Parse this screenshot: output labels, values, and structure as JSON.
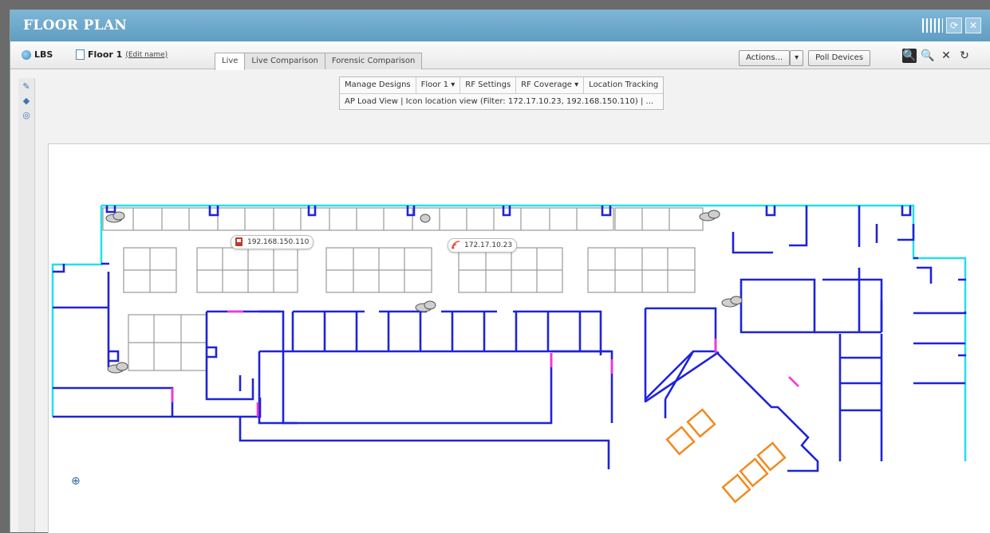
{
  "window": {
    "title": "FLOOR PLAN",
    "refresh_icon": "refresh-icon",
    "close_icon": "close-icon"
  },
  "toolbar": {
    "lbs_label": "LBS",
    "floor_label": "Floor 1",
    "edit_name_link": "(Edit name)",
    "tabs": [
      {
        "label": "Live",
        "active": true
      },
      {
        "label": "Live Comparison",
        "active": false
      },
      {
        "label": "Forensic Comparison",
        "active": false
      }
    ],
    "actions_label": "Actions...",
    "actions_caret": "▾",
    "poll_devices_label": "Poll Devices",
    "zoom_tools": [
      "zoom-select-icon",
      "zoom-out-icon",
      "fit-icon",
      "pan-icon"
    ]
  },
  "sidebar": {
    "tools": [
      "edit-icon",
      "layers-icon",
      "location-icon"
    ]
  },
  "menu": {
    "items": [
      {
        "label": "Manage Designs"
      },
      {
        "label": "Floor 1 ▾"
      },
      {
        "label": "RF Settings"
      },
      {
        "label": "RF Coverage ▾"
      },
      {
        "label": "Location Tracking"
      }
    ],
    "view_line": "AP Load View  |  Icon location view (Filter: 172.17.10.23, 192.168.150.110)  |  ..."
  },
  "floor_plan": {
    "devices": [
      {
        "label": "192.168.150.110",
        "icon": "phone-device-icon"
      },
      {
        "label": "172.17.10.23",
        "icon": "wireless-device-icon"
      }
    ],
    "colors": {
      "outer_wall": "#22e0ea",
      "inner_wall": "#1f23d8",
      "door": "#ff33cc",
      "cubicle": "#9a9a9a",
      "furniture": "#f08a1e"
    }
  }
}
